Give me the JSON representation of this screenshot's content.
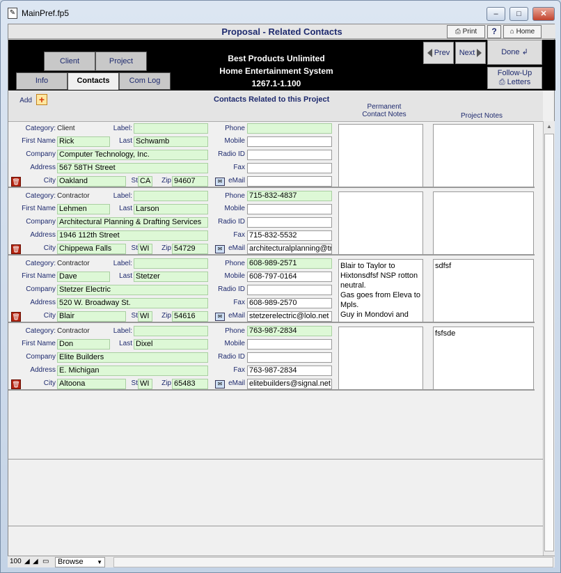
{
  "window": {
    "title": "MainPref.fp5",
    "minimize": "‒",
    "maximize": "□",
    "close": "✕"
  },
  "header": {
    "title": "Proposal - Related Contacts",
    "print_label": "Print",
    "help_label": "?",
    "home_label": "Home"
  },
  "banner": {
    "line1": "Best Products Unlimited",
    "line2": "Home Entertainment System",
    "line3": "1267.1-1.100"
  },
  "tabs": {
    "client": "Client",
    "project": "Project",
    "info": "Info",
    "contacts": "Contacts",
    "comlog": "Com Log"
  },
  "nav": {
    "prev": "Prev",
    "next": "Next",
    "done": "Done",
    "followup_line1": "Follow-Up",
    "followup_line2": "Letters"
  },
  "section": {
    "add_label": "Add",
    "title": "Contacts Related to this Project",
    "perm_notes_line1": "Permanent",
    "perm_notes_line2": "Contact Notes",
    "project_notes": "Project Notes"
  },
  "labels": {
    "category": "Category:",
    "label": "Label:",
    "first_name": "First Name",
    "last": "Last",
    "company": "Company",
    "address": "Address",
    "city": "City",
    "st": "St",
    "zip": "Zip",
    "phone": "Phone",
    "mobile": "Mobile",
    "radio_id": "Radio ID",
    "fax": "Fax",
    "email": "eMail"
  },
  "records": [
    {
      "category": "Client",
      "label": "",
      "first": "Rick",
      "last": "Schwamb",
      "company": "Computer Technology, Inc.",
      "address": "567 58TH Street",
      "city": "Oakland",
      "st": "CA",
      "zip": "94607",
      "phone": "",
      "mobile": "",
      "radio": "",
      "fax": "",
      "email": "",
      "perm_notes": "",
      "project_notes": ""
    },
    {
      "category": "Contractor",
      "label": "",
      "first": "Lehmen",
      "last": "Larson",
      "company": "Architectural Planning & Drafting Services",
      "address": "1946 112th Street",
      "city": "Chippewa Falls",
      "st": "WI",
      "zip": "54729",
      "phone": "715-832-4837",
      "mobile": "",
      "radio": "",
      "fax": "715-832-5532",
      "email": "architecturalplanning@tr",
      "perm_notes": "",
      "project_notes": ""
    },
    {
      "category": "Contractor",
      "label": "",
      "first": "Dave",
      "last": "Stetzer",
      "company": "Stetzer Electric",
      "address": "520 W. Broadway St.",
      "city": "Blair",
      "st": "WI",
      "zip": "54616",
      "phone": "608-989-2571",
      "mobile": "608-797-0164",
      "radio": "",
      "fax": "608-989-2570",
      "email": "stetzerelectric@lolo.net",
      "perm_notes": "Blair to Taylor to Hixtonsdfsf NSP rotton neutral.\nGas goes from Eleva to Mpls.\nGuy in Mondovi and",
      "project_notes": "sdfsf"
    },
    {
      "category": "Contractor",
      "label": "",
      "first": "Don",
      "last": "Dixel",
      "company": "Elite Builders",
      "address": "E. Michigan",
      "city": "Altoona",
      "st": "WI",
      "zip": "65483",
      "phone": "763-987-2834",
      "mobile": "",
      "radio": "",
      "fax": "763-987-2834",
      "email": "elitebuilders@signal.net",
      "perm_notes": "",
      "project_notes": "fsfsde"
    }
  ],
  "status": {
    "zoom": "100",
    "mode": "Browse"
  },
  "colors": {
    "field_green": "#ddf8d6",
    "label_blue": "#1e2a6e",
    "banner_black": "#000000"
  }
}
